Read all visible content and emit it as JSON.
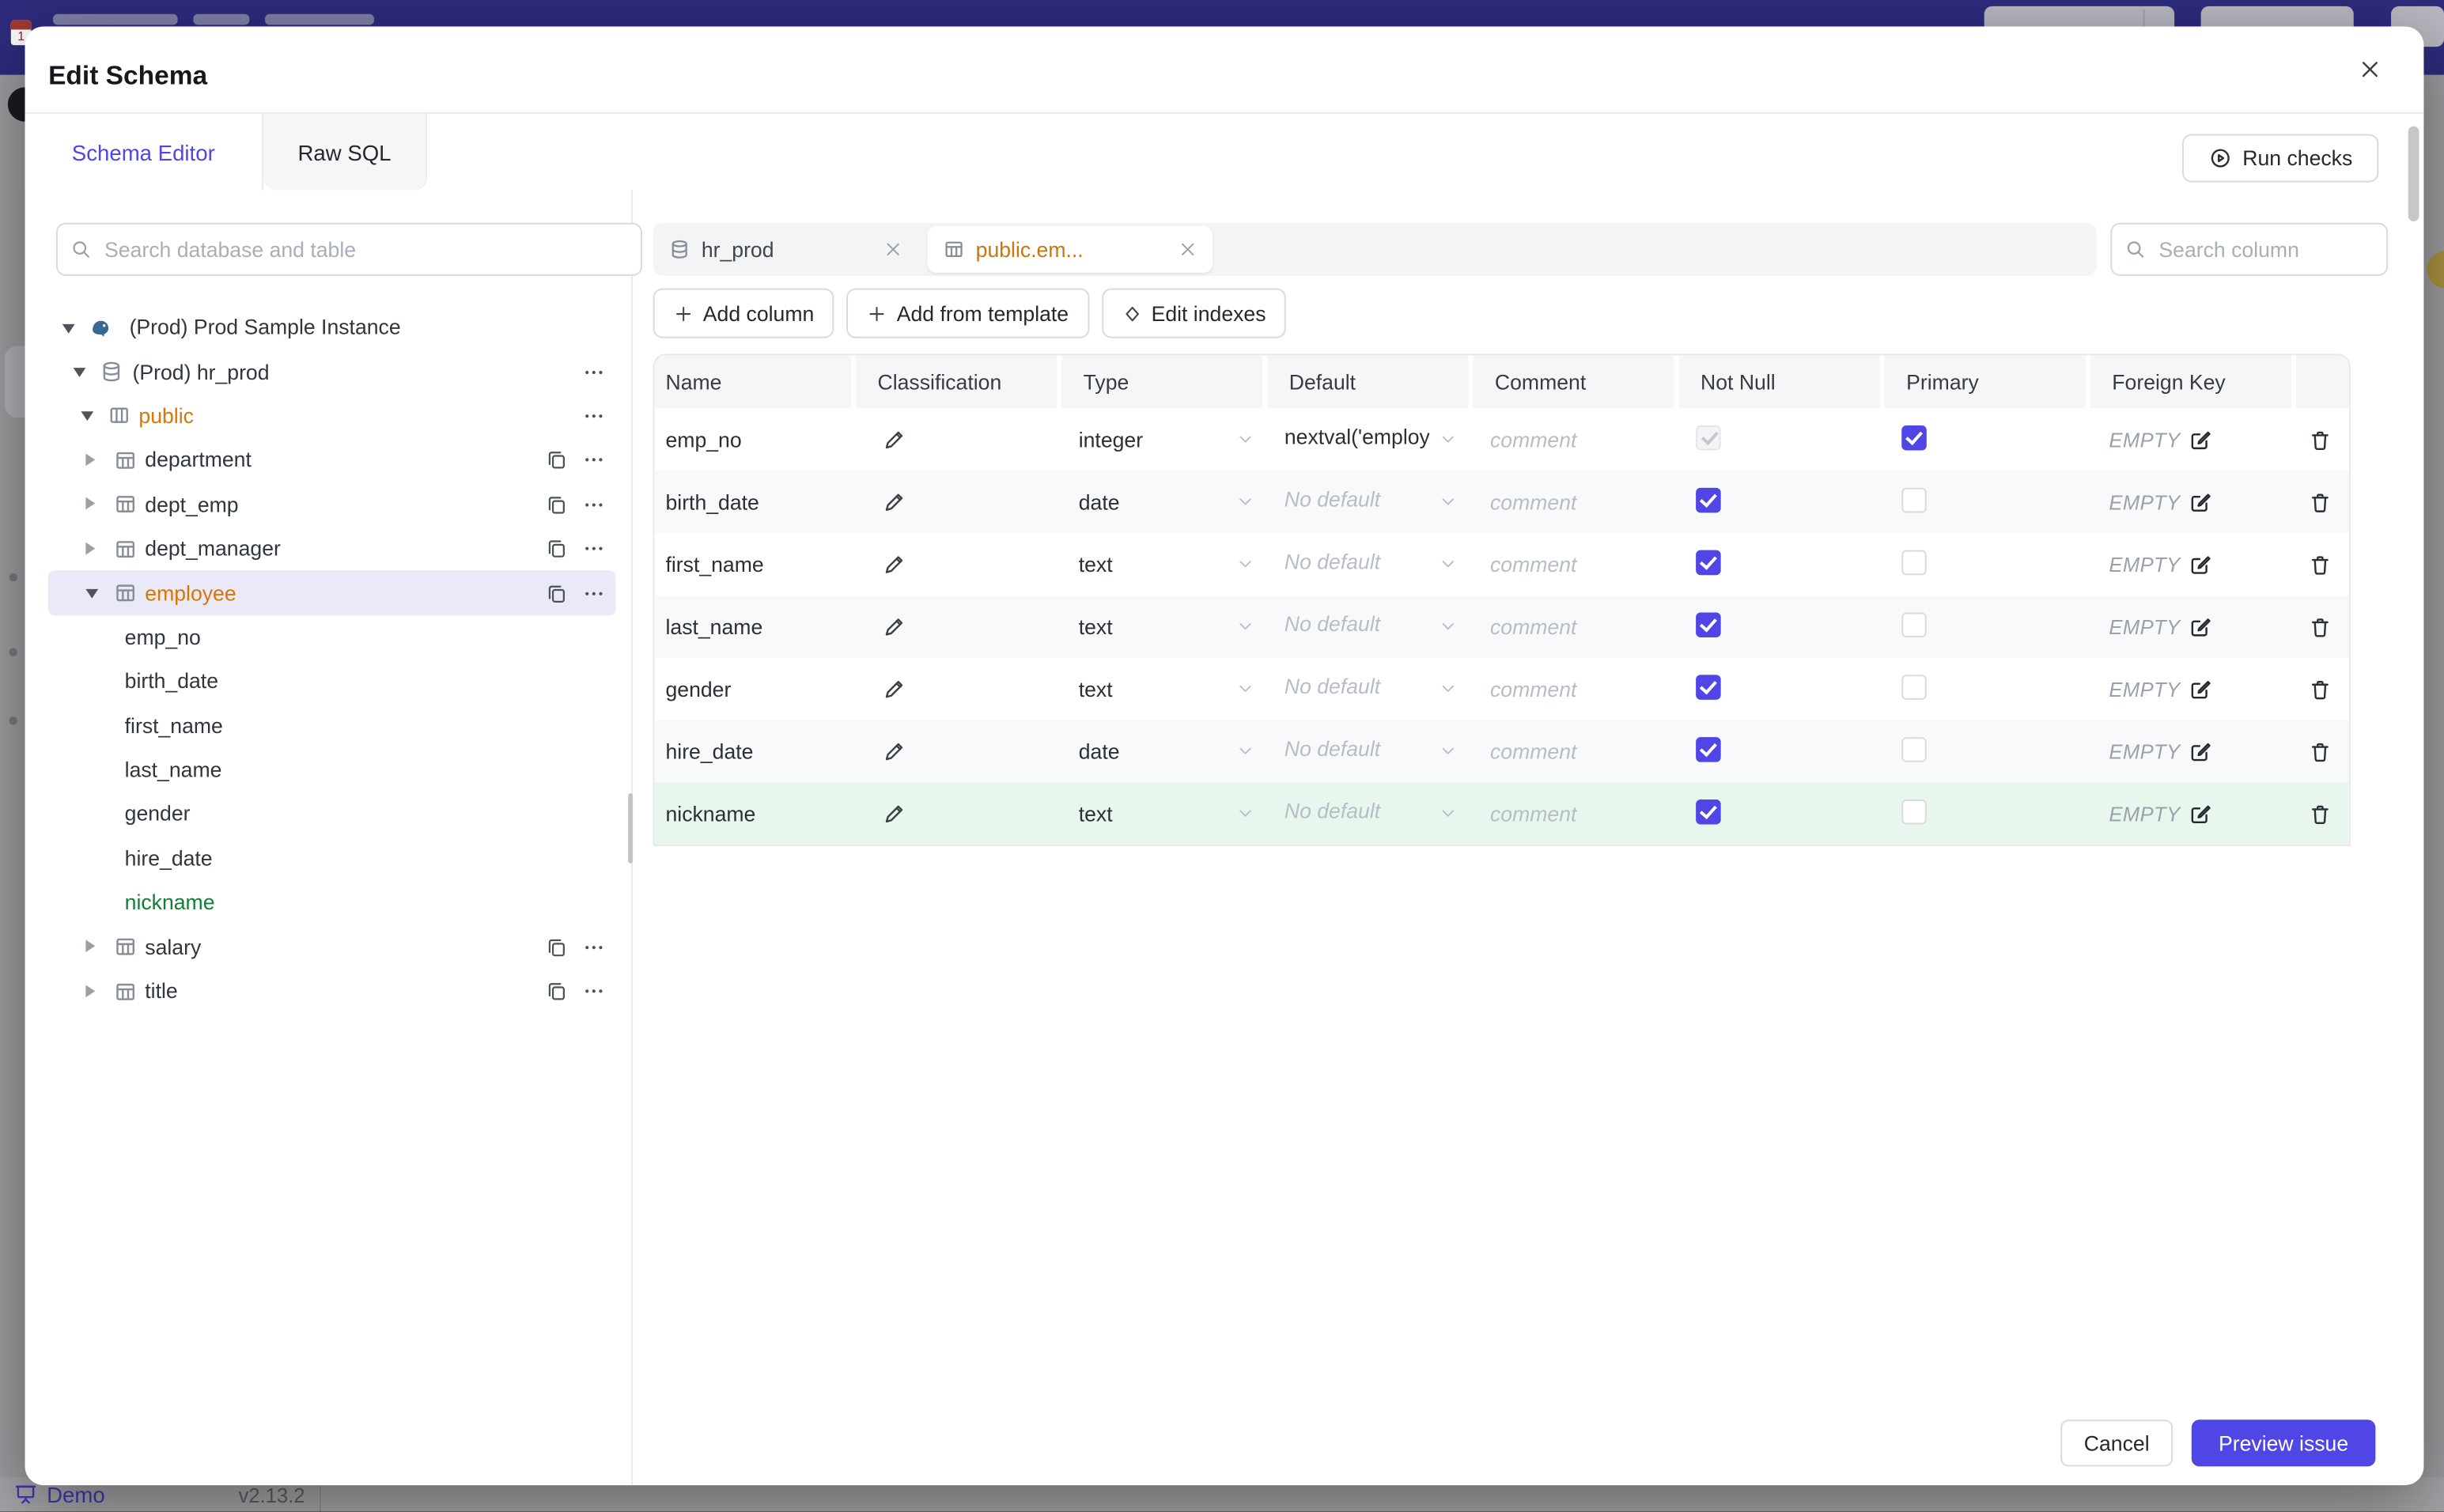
{
  "modal": {
    "title": "Edit Schema",
    "tabs": [
      {
        "label": "Schema Editor",
        "active": true
      },
      {
        "label": "Raw SQL",
        "active": false
      }
    ],
    "run_checks": "Run checks",
    "footer": {
      "cancel": "Cancel",
      "preview_issue": "Preview issue"
    }
  },
  "sidebar": {
    "search_placeholder": "Search database and table",
    "tree": [
      {
        "label": "(Prod) Prod Sample Instance",
        "icon": "postgresql",
        "level": 0,
        "expanded": true
      },
      {
        "label": "(Prod) hr_prod",
        "icon": "database",
        "level": 1,
        "expanded": true,
        "actions": [
          "more"
        ]
      },
      {
        "label": "public",
        "icon": "schema",
        "level": 2,
        "expanded": true,
        "color": "orange",
        "actions": [
          "more"
        ]
      },
      {
        "label": "department",
        "icon": "table",
        "level": 3,
        "actions": [
          "copy",
          "more"
        ]
      },
      {
        "label": "dept_emp",
        "icon": "table",
        "level": 3,
        "actions": [
          "copy",
          "more"
        ]
      },
      {
        "label": "dept_manager",
        "icon": "table",
        "level": 3,
        "actions": [
          "copy",
          "more"
        ]
      },
      {
        "label": "employee",
        "icon": "table",
        "level": 3,
        "expanded": true,
        "selected": true,
        "color": "orange",
        "actions": [
          "copy",
          "more"
        ]
      },
      {
        "label": "emp_no",
        "level": 4
      },
      {
        "label": "birth_date",
        "level": 4
      },
      {
        "label": "first_name",
        "level": 4
      },
      {
        "label": "last_name",
        "level": 4
      },
      {
        "label": "gender",
        "level": 4
      },
      {
        "label": "hire_date",
        "level": 4
      },
      {
        "label": "nickname",
        "level": 4,
        "color": "green"
      },
      {
        "label": "salary",
        "icon": "table",
        "level": 3,
        "actions": [
          "copy",
          "more"
        ]
      },
      {
        "label": "title",
        "icon": "table",
        "level": 3,
        "actions": [
          "copy",
          "more"
        ]
      }
    ]
  },
  "editor": {
    "chips": [
      {
        "label": "hr_prod",
        "icon": "database",
        "active": false
      },
      {
        "label": "public.em...",
        "icon": "table",
        "active": true
      }
    ],
    "search_placeholder": "Search column",
    "toolbar": [
      {
        "label": "Add column",
        "icon": "plus"
      },
      {
        "label": "Add from template",
        "icon": "plus"
      },
      {
        "label": "Edit indexes",
        "icon": "diamond"
      }
    ],
    "table": {
      "headers": [
        "Name",
        "Classification",
        "Type",
        "Default",
        "Comment",
        "Not Null",
        "Primary",
        "Foreign Key"
      ],
      "comment_placeholder": "comment",
      "rows": [
        {
          "name": "emp_no",
          "type": "integer",
          "default": "nextval('employ",
          "default_set": true,
          "not_null": true,
          "not_null_disabled": true,
          "primary": true,
          "foreign_key": "EMPTY"
        },
        {
          "name": "birth_date",
          "type": "date",
          "default": "No default",
          "default_set": false,
          "not_null": true,
          "primary": false,
          "foreign_key": "EMPTY"
        },
        {
          "name": "first_name",
          "type": "text",
          "default": "No default",
          "default_set": false,
          "not_null": true,
          "primary": false,
          "foreign_key": "EMPTY"
        },
        {
          "name": "last_name",
          "type": "text",
          "default": "No default",
          "default_set": false,
          "not_null": true,
          "primary": false,
          "foreign_key": "EMPTY"
        },
        {
          "name": "gender",
          "type": "text",
          "default": "No default",
          "default_set": false,
          "not_null": true,
          "primary": false,
          "foreign_key": "EMPTY"
        },
        {
          "name": "hire_date",
          "type": "date",
          "default": "No default",
          "default_set": false,
          "not_null": true,
          "primary": false,
          "foreign_key": "EMPTY"
        },
        {
          "name": "nickname",
          "type": "text",
          "default": "No default",
          "default_set": false,
          "not_null": true,
          "primary": false,
          "foreign_key": "EMPTY",
          "added": true
        }
      ]
    }
  },
  "background": {
    "brand": "Demo",
    "version": "v2.13.2"
  },
  "colors": {
    "accent": "#4f46e5",
    "topbar": "#2e2b7d",
    "orange": "#d97706",
    "green": "#0f8136",
    "added_row_bg": "#e9f6ee",
    "selected_tree_bg": "#e9e9f8"
  }
}
